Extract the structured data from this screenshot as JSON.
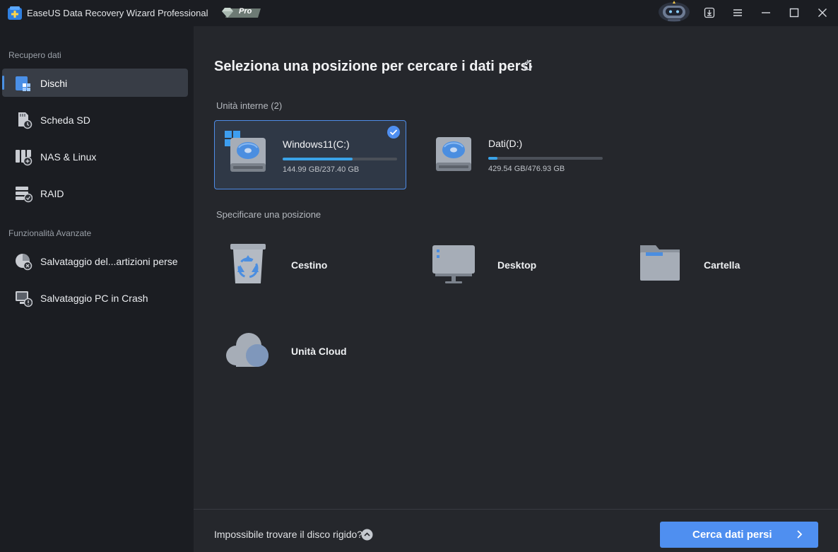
{
  "window": {
    "title": "EaseUS Data Recovery Wizard Professional",
    "badge": "Pro",
    "controls": [
      "download-icon",
      "menu-icon",
      "minimize-icon",
      "maximize-icon",
      "close-icon"
    ]
  },
  "sidebar": {
    "section_recovery": "Recupero dati",
    "section_advanced": "Funzionalità Avanzate",
    "items": [
      {
        "label": "Dischi",
        "icon": "disk-icon",
        "active": true
      },
      {
        "label": "Scheda SD",
        "icon": "sd-card-icon",
        "active": false
      },
      {
        "label": "NAS & Linux",
        "icon": "nas-icon",
        "active": false
      },
      {
        "label": "RAID",
        "icon": "raid-icon",
        "active": false
      },
      {
        "label": "Salvataggio del...artizioni perse",
        "icon": "lost-partition-icon",
        "active": false
      },
      {
        "label": "Salvataggio PC in Crash",
        "icon": "crashed-pc-icon",
        "active": false
      }
    ]
  },
  "main": {
    "title": "Seleziona una posizione per cercare i dati persi",
    "internal_drives_label": "Unità interne (2)",
    "specify_location_label": "Specificare una posizione",
    "drives": [
      {
        "name": "Windows11(C:)",
        "size": "144.99 GB/237.40 GB",
        "used_fraction": 0.61,
        "selected": true
      },
      {
        "name": "Dati(D:)",
        "size": "429.54 GB/476.93 GB",
        "used_fraction": 0.08,
        "selected": false
      }
    ],
    "locations": [
      {
        "label": "Cestino",
        "icon": "recycle-bin-icon"
      },
      {
        "label": "Desktop",
        "icon": "desktop-icon"
      },
      {
        "label": "Cartella",
        "icon": "folder-icon"
      },
      {
        "label": "Unità Cloud",
        "icon": "cloud-icon"
      }
    ],
    "help_text": "Impossibile trovare il disco rigido?",
    "scan_button": "Cerca dati persi"
  },
  "colors": {
    "accent": "#4f8ff0",
    "progress": "#3aa3e8",
    "sidebar_active": "#383d46",
    "main_bg": "#25272c"
  }
}
